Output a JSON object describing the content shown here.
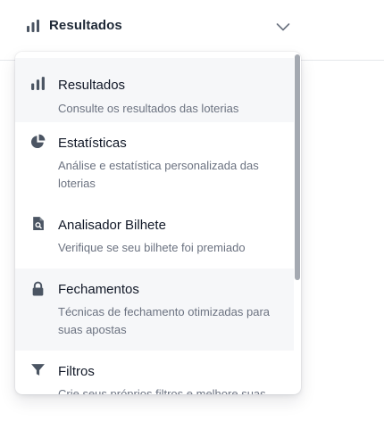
{
  "selector": {
    "selected_label": "Resultados",
    "icon": "bar-chart-icon",
    "chevron_icon": "chevron-down-icon"
  },
  "menu": {
    "items": [
      {
        "title": "Resultados",
        "description": "Consulte os resultados das loterias",
        "icon": "bar-chart-icon",
        "highlighted": true
      },
      {
        "title": "Estatísticas",
        "description": "Análise e estatística personalizada das loterias",
        "icon": "pie-chart-icon",
        "highlighted": false
      },
      {
        "title": "Analisador Bilhete",
        "description": "Verifique se seu bilhete foi premiado",
        "icon": "document-search-icon",
        "highlighted": false
      },
      {
        "title": "Fechamentos",
        "description": "Técnicas de fechamento otimizadas para suas apostas",
        "icon": "lock-icon",
        "highlighted": true
      },
      {
        "title": "Filtros",
        "description": "Crie seus próprios filtros e melhore suas",
        "icon": "filter-icon",
        "highlighted": false
      }
    ]
  },
  "colors": {
    "icon": "#4b5563",
    "text": "#111827",
    "muted": "#6b7280",
    "highlight_bg": "#f6f7f9",
    "scrollbar": "#a4a9b1"
  }
}
